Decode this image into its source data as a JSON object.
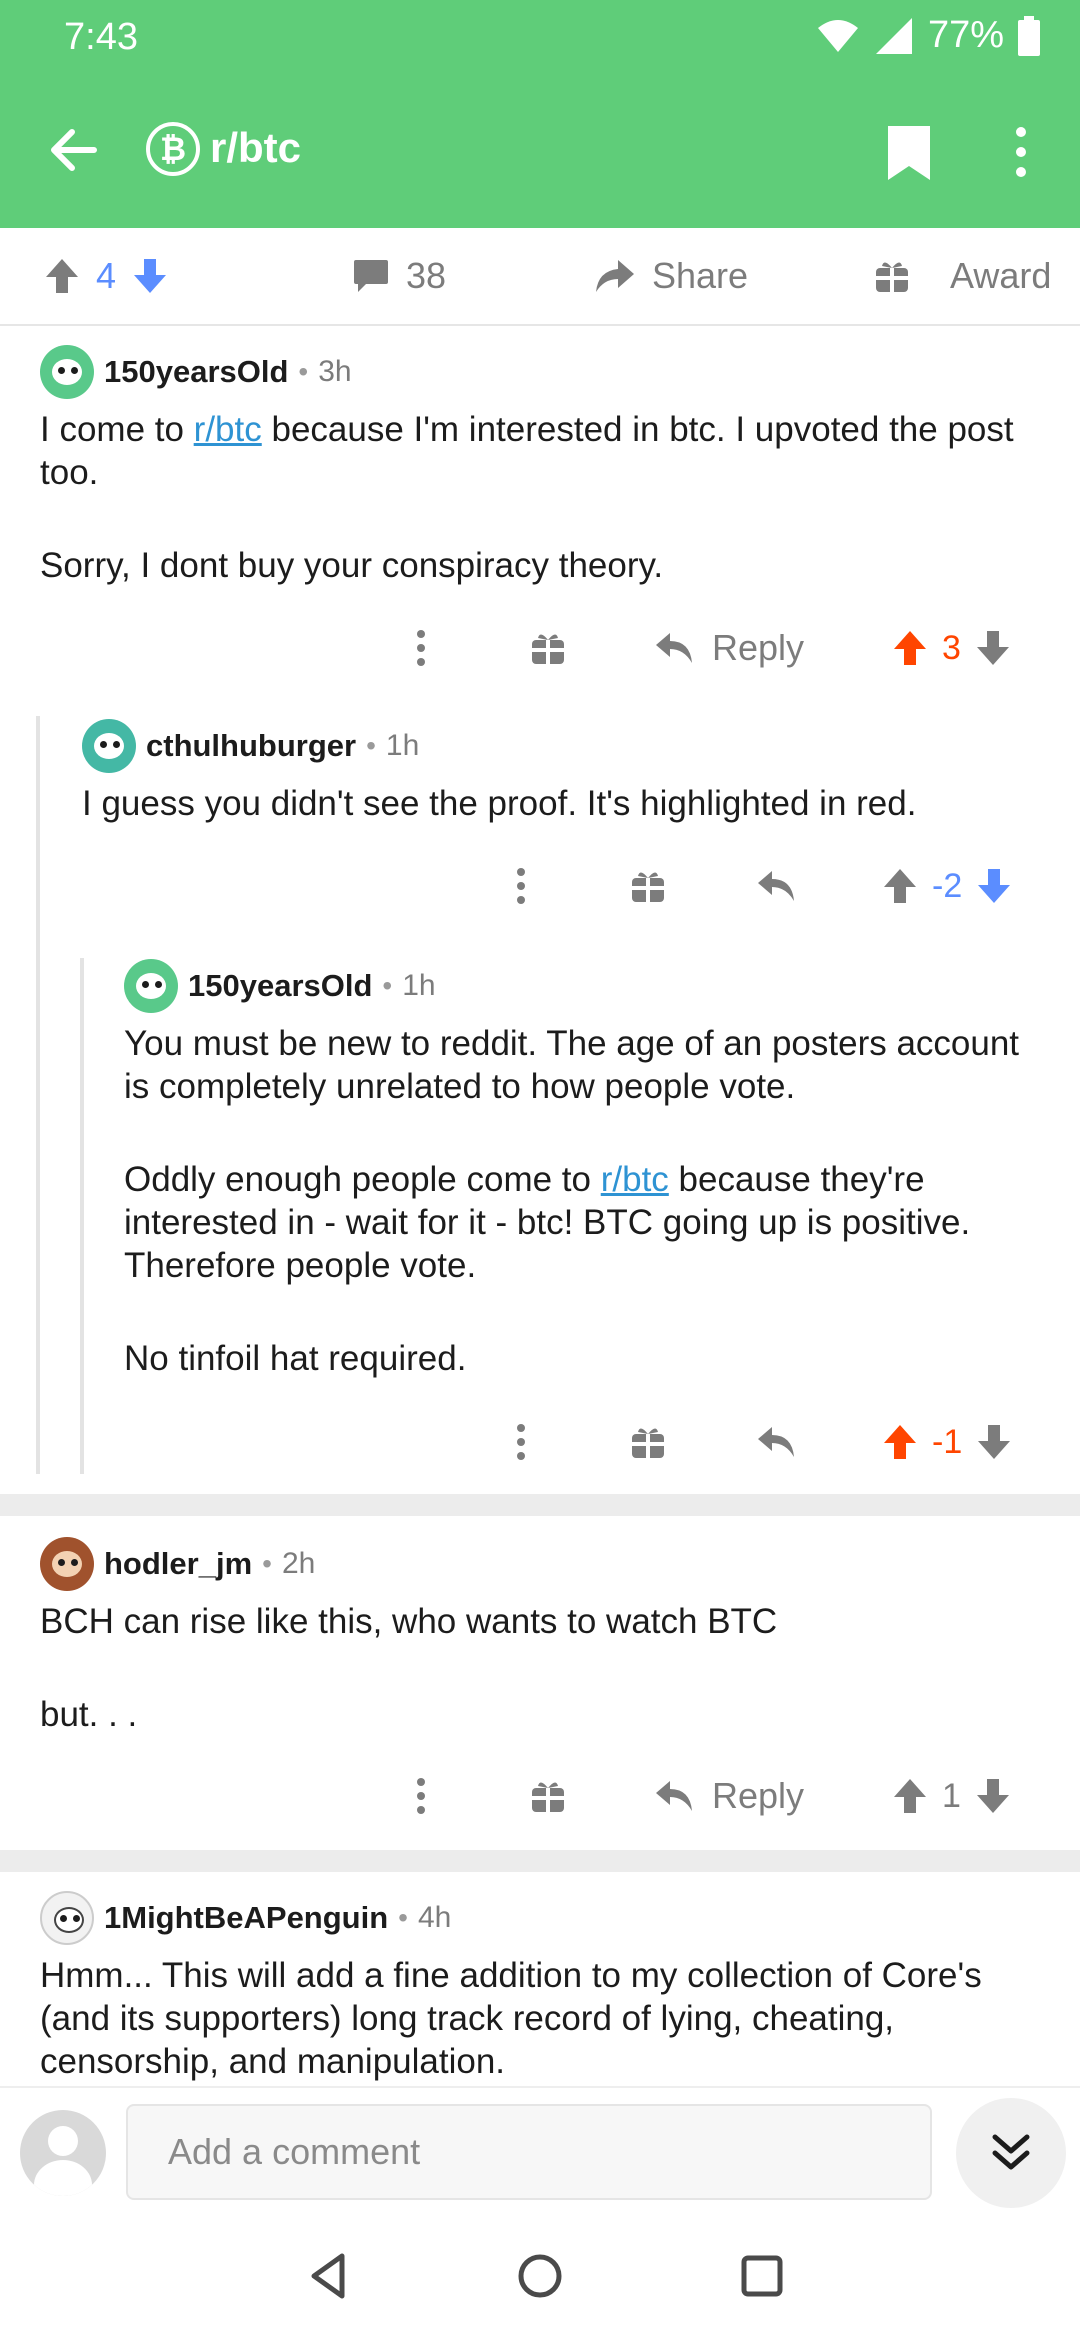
{
  "status": {
    "time": "7:43",
    "battery": "77%"
  },
  "appbar": {
    "subreddit": "r/btc",
    "sub_icon_glyph": "₿"
  },
  "postbar": {
    "upvotes": "4",
    "comments": "38",
    "share": "Share",
    "award": "Award"
  },
  "colors": {
    "header": "#5fcd79",
    "upvote_active": "#ff4500",
    "downvote_active": "#5b8dff",
    "link": "#2e93d3"
  },
  "comments": [
    {
      "user": "150yearsOld",
      "time": "3h",
      "body_p1_before": "I come to ",
      "body_p1_link": "r/btc",
      "body_p1_after": " because I'm interested in btc. I upvoted the post too.",
      "body_p2": "Sorry, I dont buy your conspiracy theory.",
      "reply": "Reply",
      "score": "3"
    },
    {
      "user": "cthulhuburger",
      "time": "1h",
      "body": "I guess you didn't see the proof. It's highlighted in red.",
      "score": "-2"
    },
    {
      "user": "150yearsOld",
      "time": "1h",
      "body_p1": "You must be new to reddit. The age of an posters account is completely unrelated to how people vote.",
      "body_p2_before": "Oddly enough people come to ",
      "body_p2_link": "r/btc",
      "body_p2_after": " because they're interested in - wait for it - btc!  BTC going up is positive. Therefore people vote.",
      "body_p3": "No tinfoil hat required.",
      "score": "-1"
    },
    {
      "user": "hodler_jm",
      "time": "2h",
      "body_p1": "BCH can rise like this, who wants to watch BTC",
      "body_p2": "but. . .",
      "reply": "Reply",
      "score": "1"
    },
    {
      "user": "1MightBeAPenguin",
      "time": "4h",
      "body": "Hmm... This will add a fine addition to my collection of Core's (and its supporters) long track record of lying, cheating, censorship, and manipulation."
    }
  ],
  "composer": {
    "placeholder": "Add a comment"
  },
  "icons": [
    "back-arrow-icon",
    "bitcoin-icon",
    "bookmark-icon",
    "more-vertical-icon",
    "upvote-icon",
    "downvote-icon",
    "comment-icon",
    "share-icon",
    "award-icon",
    "reply-icon",
    "chevron-double-down-icon",
    "nav-back-icon",
    "nav-home-icon",
    "nav-recents-icon"
  ]
}
